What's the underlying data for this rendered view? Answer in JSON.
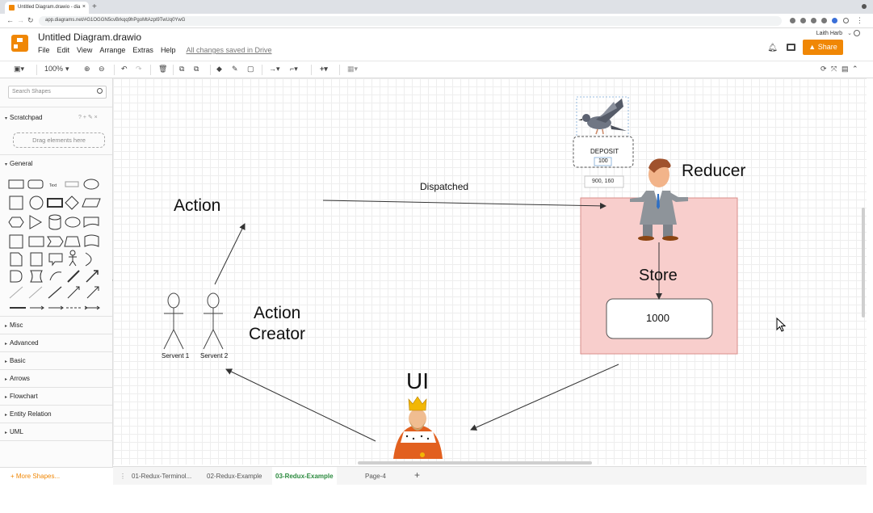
{
  "browser": {
    "tab_title": "Untitled Diagram.drawio - dia",
    "tab_close": "×",
    "new_tab": "+",
    "url": "app.diagrams.net/#G1OGGN5cvBrkqq9hPgoMtAzpl9TwUq0YwG"
  },
  "header": {
    "doc_title": "Untitled Diagram.drawio",
    "menu": [
      "File",
      "Edit",
      "View",
      "Arrange",
      "Extras",
      "Help"
    ],
    "save_status": "All changes saved in Drive",
    "user_name": "Laith Harb",
    "share_label": "Share"
  },
  "toolbar": {
    "zoom": "100%"
  },
  "sidebar": {
    "search_placeholder": "Search Shapes",
    "scratchpad": "Scratchpad",
    "scratch_tools": "? + ✎ ×",
    "drag_hint": "Drag elements here",
    "general": "General",
    "text_shape": "Text",
    "sections": [
      "Misc",
      "Advanced",
      "Basic",
      "Arrows",
      "Flowchart",
      "Entity Relation",
      "UML"
    ],
    "more_shapes": "+ More Shapes..."
  },
  "diagram": {
    "action": "Action",
    "action_creator_line1": "Action",
    "action_creator_line2": "Creator",
    "servant1": "Servent 1",
    "servant2": "Servent 2",
    "dispatched": "Dispatched",
    "deposit": "DEPOSIT",
    "deposit_value": "100",
    "coords": "900, 160",
    "reducer": "Reducer",
    "store": "Store",
    "store_value": "1000",
    "ui": "UI"
  },
  "pages": {
    "tabs": [
      "01-Redux-Terminol...",
      "02-Redux-Example",
      "03-Redux-Example",
      "Page-4"
    ],
    "add": "+"
  }
}
